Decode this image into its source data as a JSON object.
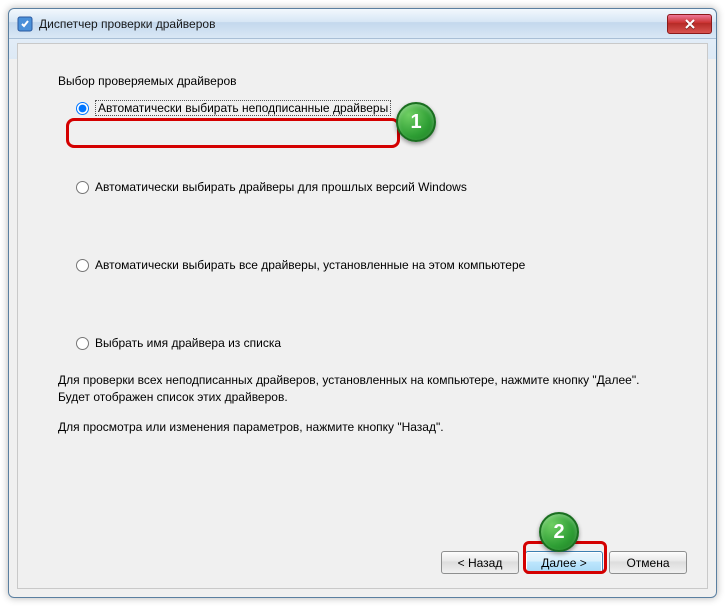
{
  "window": {
    "title": "Диспетчер проверки драйверов"
  },
  "group": {
    "title": "Выбор проверяемых драйверов"
  },
  "options": [
    {
      "label": "Автоматически выбирать неподписанные драйверы",
      "selected": true
    },
    {
      "label": "Автоматически выбирать драйверы для прошлых версий Windows",
      "selected": false
    },
    {
      "label": "Автоматически выбирать все драйверы, установленные на этом компьютере",
      "selected": false
    },
    {
      "label": "Выбрать имя драйвера из списка",
      "selected": false
    }
  ],
  "info": {
    "line1": "Для проверки всех неподписанных драйверов, установленных на компьютере, нажмите кнопку \"Далее\". Будет отображен список этих драйверов.",
    "line2": "Для просмотра или изменения параметров, нажмите кнопку \"Назад\"."
  },
  "buttons": {
    "back": "< Назад",
    "next": "Далее >",
    "cancel": "Отмена"
  },
  "annotations": {
    "badge1": "1",
    "badge2": "2"
  }
}
